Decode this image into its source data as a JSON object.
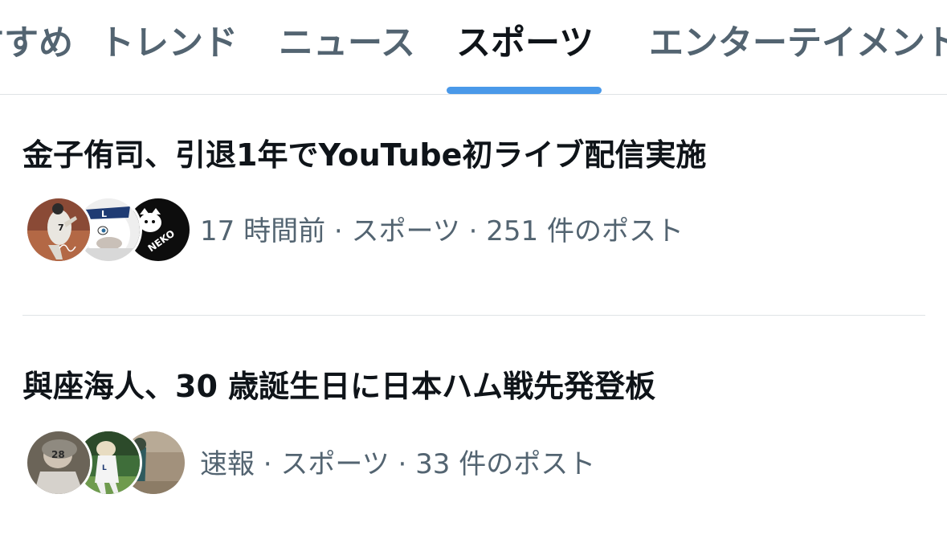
{
  "tabs": [
    {
      "label": "すすめ"
    },
    {
      "label": "トレンド"
    },
    {
      "label": "ニュース"
    },
    {
      "label": "スポーツ",
      "active": true
    },
    {
      "label": "エンターテイメント"
    }
  ],
  "trends": [
    {
      "title": "金子侑司、引退1年でYouTube初ライブ配信実施",
      "meta": "17 時間前 · スポーツ · 251 件のポスト",
      "avatars": [
        "baseball-player-photo",
        "mascot-photo",
        "neko-logo"
      ],
      "avatar_text": [
        "7",
        "NEKO"
      ]
    },
    {
      "title": "與座海人、30 歳誕生日に日本ハム戦先発登板",
      "meta": "速報 · スポーツ · 33 件のポスト",
      "avatars": [
        "person-photo",
        "mascot-field-photo",
        "player-photo"
      ],
      "avatar_text": [
        "28"
      ]
    }
  ],
  "colors": {
    "accent": "#4a99e9",
    "text_primary": "#0f1419",
    "text_secondary": "#536471",
    "divider": "#dfe3e6"
  }
}
